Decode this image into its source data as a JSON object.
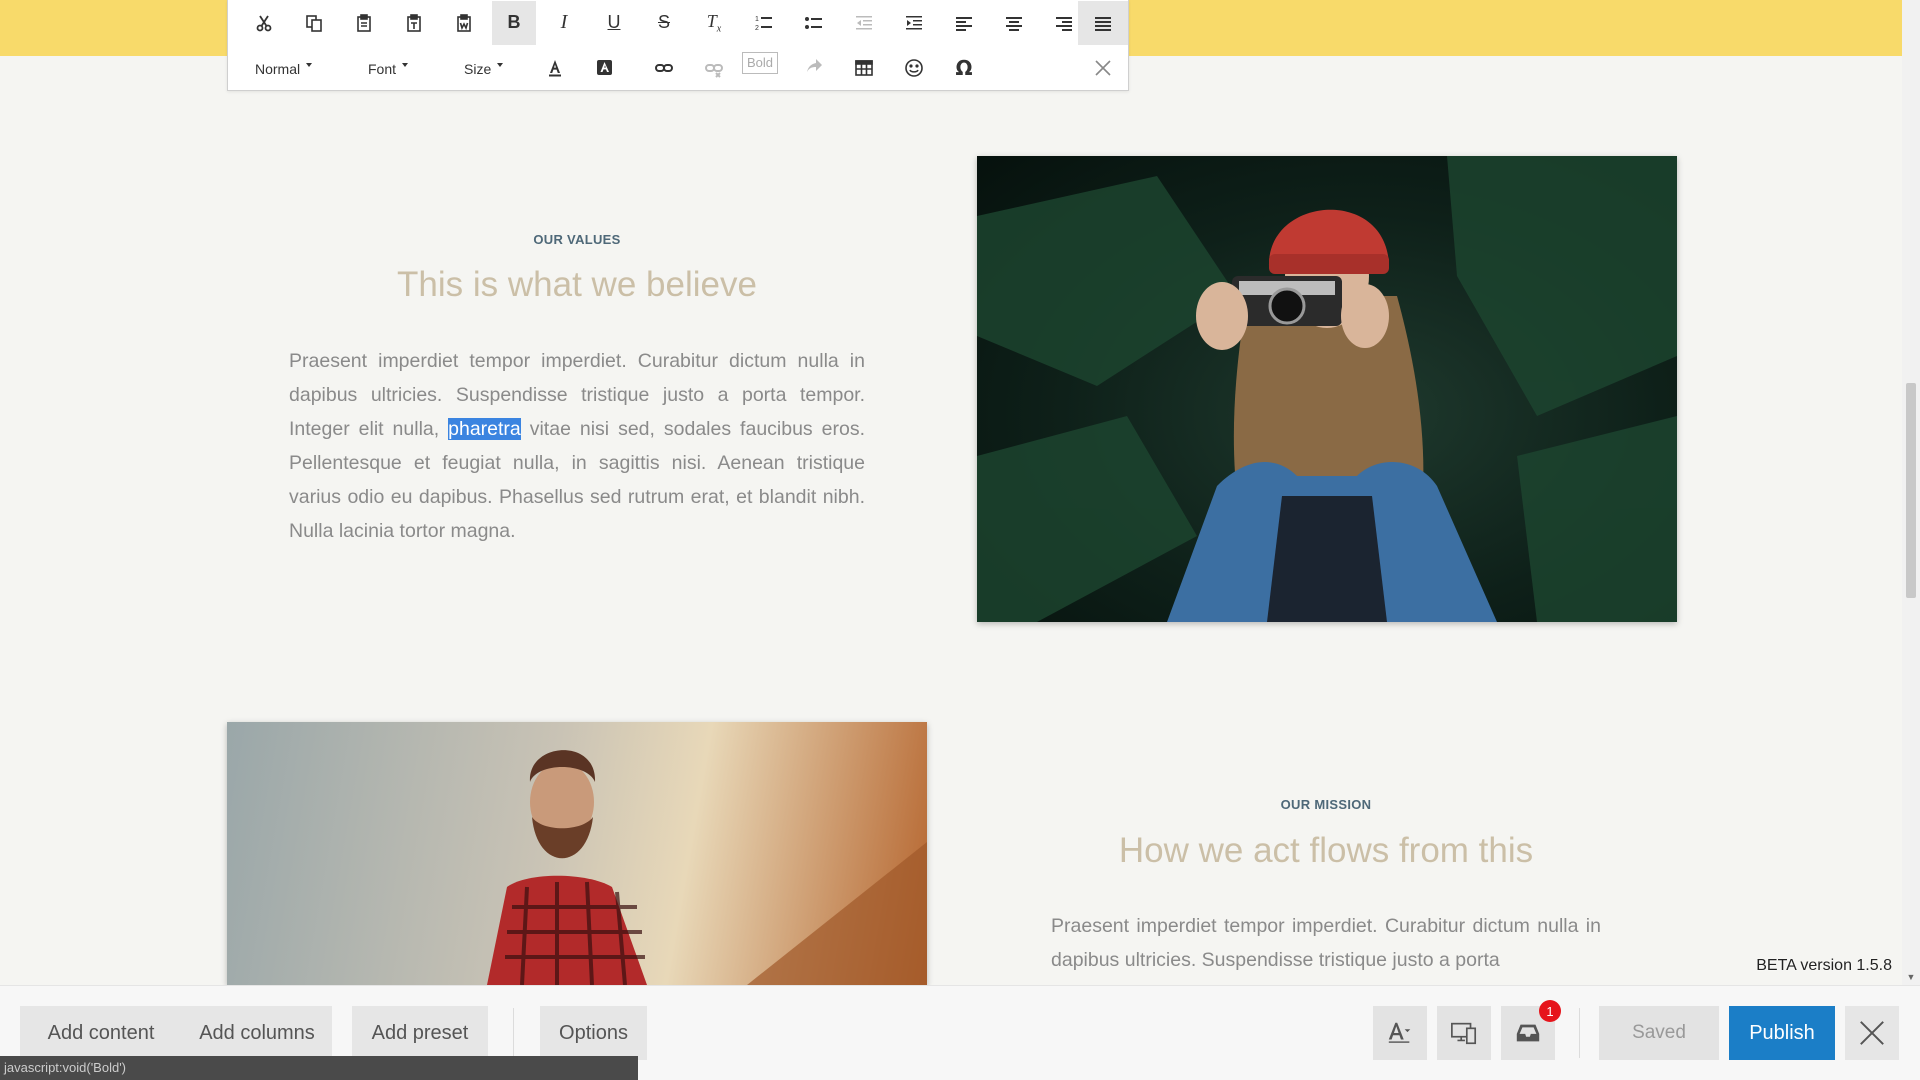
{
  "editor": {
    "toolbar": {
      "row1": [
        "cut-icon",
        "copy-icon",
        "paste-icon",
        "paste-text-icon",
        "paste-word-icon",
        "bold-icon",
        "italic-icon",
        "underline-icon",
        "strikethrough-icon",
        "remove-format-icon",
        "numbered-list-icon",
        "bulleted-list-icon",
        "outdent-icon",
        "indent-icon",
        "align-left-icon",
        "align-center-icon",
        "align-right-icon",
        "justify-icon"
      ],
      "format_label": "Normal",
      "font_label": "Font",
      "size_label": "Size",
      "tooltip": "Bold"
    }
  },
  "section1": {
    "eyebrow": "OUR VALUES",
    "heading": "This is what we believe",
    "para_before": "Praesent imperdiet tempor imperdiet. Curabitur dictum nulla in dapibus ultricies. Suspendisse tristique justo a porta tempor. Integer elit nulla, ",
    "para_selected": "pharetra",
    "para_after": " vitae nisi sed, sodales faucibus eros. Pellentesque et feugiat nulla, in sagittis nisi. Aenean tristique varius odio eu dapibus. Phasellus sed rutrum erat, et blandit nibh. Nulla lacinia tortor magna."
  },
  "section2": {
    "eyebrow": "OUR MISSION",
    "heading": "How we act flows from this",
    "para": "Praesent imperdiet tempor imperdiet. Curabitur dictum nulla in dapibus ultricies. Suspendisse tristique justo a porta"
  },
  "footer": {
    "beta": "BETA version 1.5.8",
    "add_content": "Add content",
    "add_columns": "Add columns",
    "add_preset": "Add preset",
    "options": "Options",
    "badge_count": "1",
    "saved": "Saved",
    "publish": "Publish",
    "status_url": "javascript:void('Bold')"
  },
  "colors": {
    "top_band": "#f8da6a",
    "publish": "#1b7ec7",
    "heading": "#cbbfa7",
    "selection": "#3b84e0"
  }
}
